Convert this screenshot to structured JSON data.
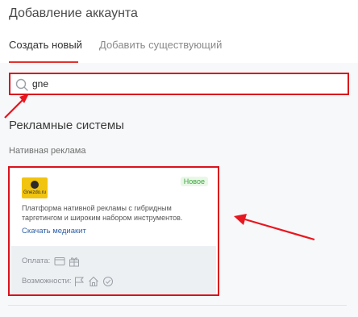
{
  "header": {
    "title": "Добавление аккаунта"
  },
  "tabs": [
    {
      "label": "Создать новый",
      "active": true
    },
    {
      "label": "Добавить существующий",
      "active": false
    }
  ],
  "search": {
    "value": "gne",
    "placeholder": ""
  },
  "section": {
    "title": "Рекламные системы",
    "subtitle": "Нативная реклама"
  },
  "card": {
    "logo_text": "Gnezdo.ru",
    "badge": "Новое",
    "description": "Платформа нативной рекламы с гибридным таргетингом и широким набором инструментов.",
    "link": "Скачать медиакит",
    "payment_label": "Оплата:",
    "features_label": "Возможности:",
    "payment_icons": [
      "credit-card-icon",
      "gift-icon"
    ],
    "feature_icons": [
      "flag-icon",
      "home-icon",
      "check-circle-icon"
    ]
  },
  "colors": {
    "highlight": "#d9121c",
    "tab_underline": "#e2322c",
    "link": "#2d5fa8",
    "badge_bg": "#e9f7e7",
    "badge_text": "#3aa63c",
    "logo_bg": "#f1c40f"
  }
}
